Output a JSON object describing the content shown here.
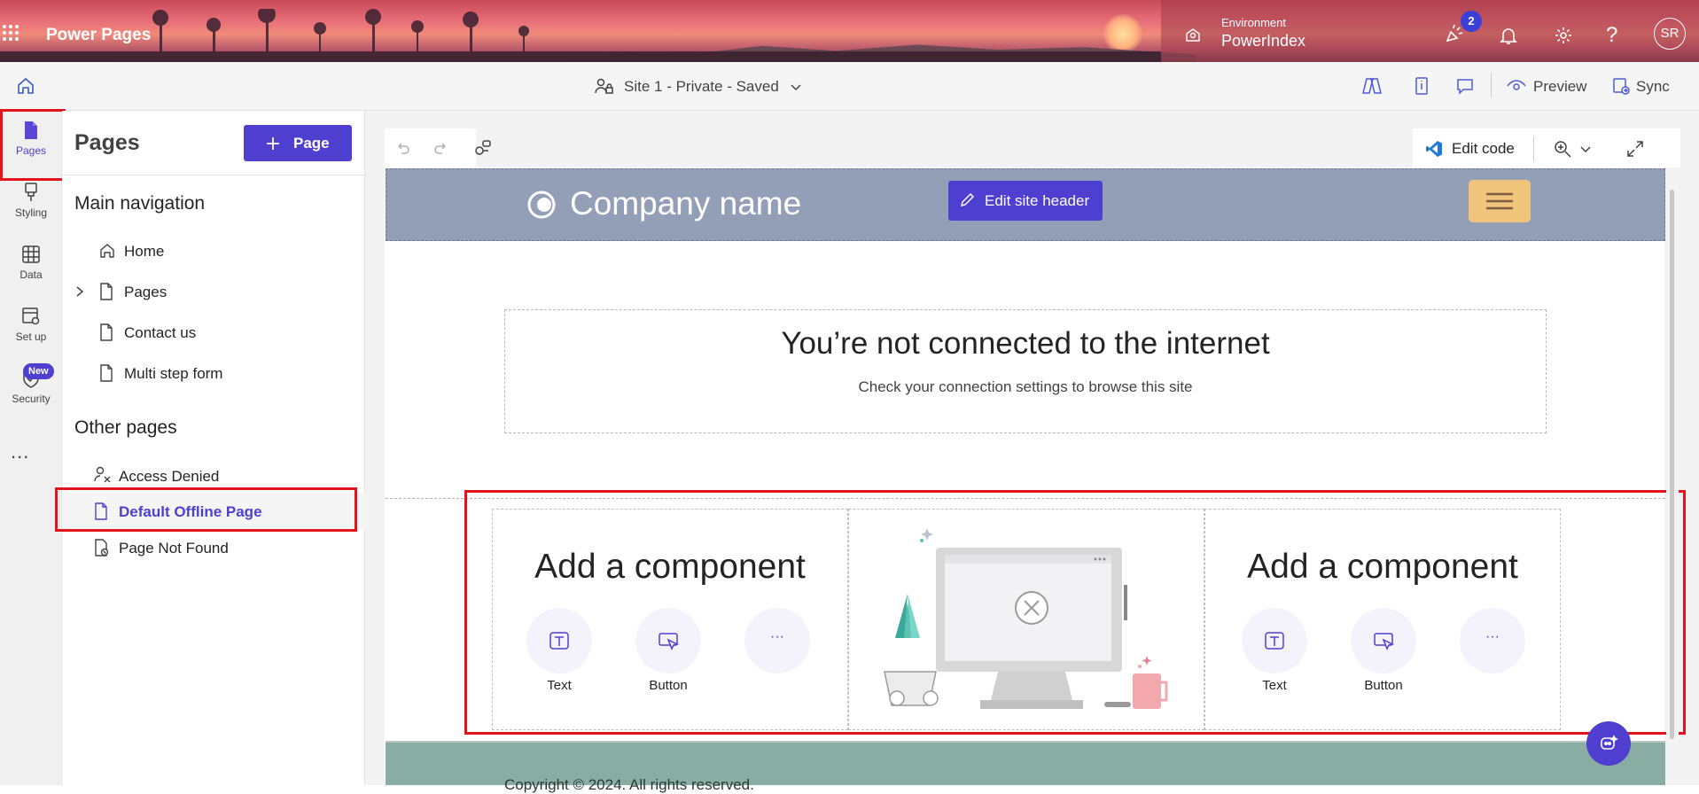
{
  "app": {
    "title": "Power Pages"
  },
  "environment": {
    "label": "Environment",
    "name": "PowerIndex"
  },
  "header": {
    "notification_count": "2",
    "avatar": "SR"
  },
  "commandbar": {
    "site_status": "Site 1 - Private - Saved",
    "preview_label": "Preview",
    "sync_label": "Sync"
  },
  "rail": {
    "items": [
      {
        "label": "Pages"
      },
      {
        "label": "Styling"
      },
      {
        "label": "Data"
      },
      {
        "label": "Set up"
      },
      {
        "label": "Security",
        "badge": "New"
      }
    ],
    "more": "..."
  },
  "panel": {
    "title": "Pages",
    "add_label": "Page",
    "main_nav_heading": "Main navigation",
    "main_nav": [
      {
        "label": "Home"
      },
      {
        "label": "Pages"
      },
      {
        "label": "Contact us"
      },
      {
        "label": "Multi step form"
      }
    ],
    "other_heading": "Other pages",
    "other_pages": [
      {
        "label": "Access Denied"
      },
      {
        "label": "Default Offline Page"
      },
      {
        "label": "Page Not Found"
      }
    ]
  },
  "canvas_toolbar": {
    "edit_code": "Edit code"
  },
  "site": {
    "company_name": "Company name",
    "edit_header": "Edit site header",
    "offline_title": "You’re not connected to the internet",
    "offline_sub": "Check your connection settings to browse this site",
    "add_component": "Add a component",
    "text_label": "Text",
    "button_label": "Button",
    "more_label": "···",
    "footer": "Copyright © 2024. All rights reserved."
  },
  "colors": {
    "accent": "#4f3fd0",
    "site_header_bg": "#939fb7",
    "footer_bg": "#8aada3",
    "hamburger_bg": "#f0c47a",
    "highlight": "#e3131c"
  }
}
